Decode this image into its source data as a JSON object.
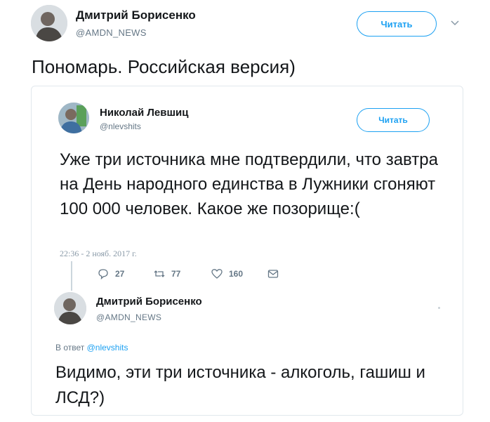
{
  "header": {
    "author_name": "Дмитрий Борисенко",
    "author_handle": "@AMDN_NEWS",
    "follow_label": "Читать",
    "menu_icon": "chevron-down-icon"
  },
  "tweet": {
    "text": "Пономарь. Российская версия)"
  },
  "quoted_tweet": {
    "author_name": "Николай Левшиц",
    "author_handle": "@nlevshits",
    "follow_label": "Читать",
    "text": "Уже три источника мне подтвердили, что завтра на День народного единства в Лужники сгоняют 100 000 человек. Какое же позорище:(",
    "timestamp": "22:36 - 2 нояб. 2017 г.",
    "actions": {
      "replies": "27",
      "retweets": "77",
      "likes": "160"
    },
    "reply": {
      "author_name": "Дмитрий Борисенко",
      "author_handle": "@AMDN_NEWS",
      "reply_to_prefix": "В ответ",
      "reply_to_handle": "@nlevshits",
      "text": "Видимо, эти три источника - алкоголь, гашиш и ЛСД?)"
    }
  },
  "colors": {
    "accent": "#1da1f2",
    "secondary_text": "#657786",
    "border": "#e1e8ed"
  }
}
